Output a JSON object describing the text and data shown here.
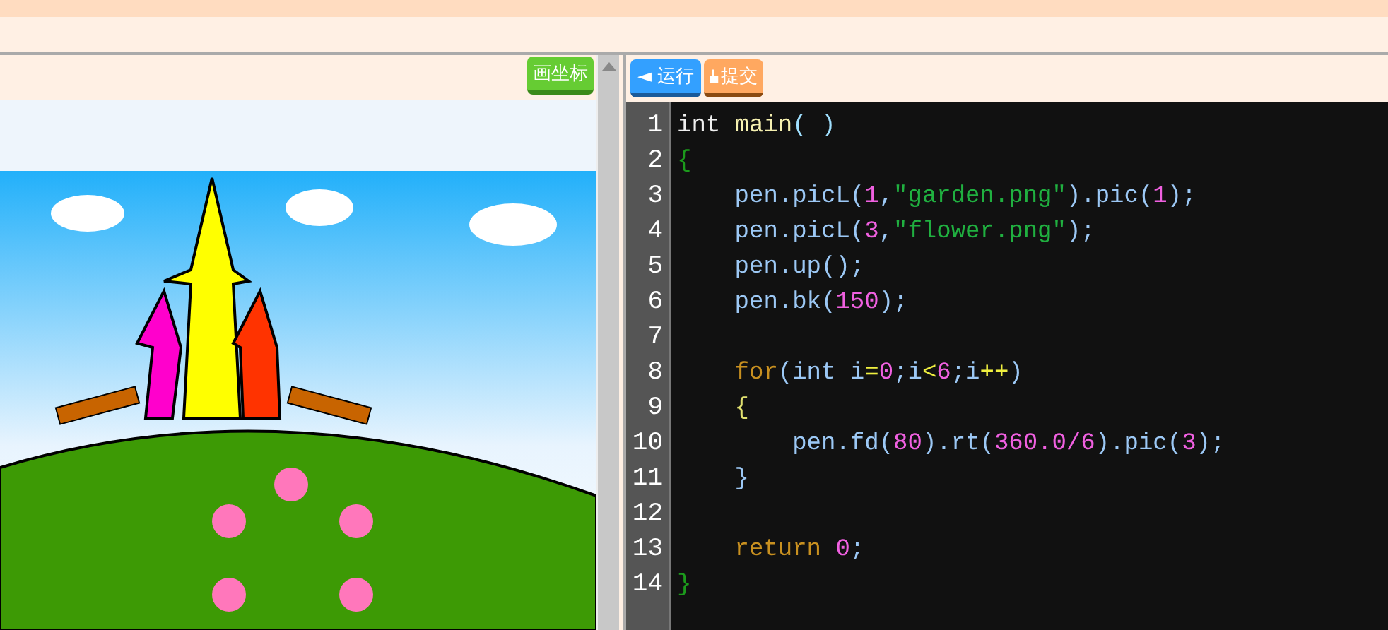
{
  "canvas_panel": {
    "button": "画坐标"
  },
  "editor": {
    "run_button": "◄ 运行",
    "submit_button": "提交",
    "lines": [
      {
        "number": "1",
        "tokens": [
          {
            "kind": "type",
            "text": "int"
          },
          {
            "kind": "func",
            "text": "main",
            "spaced": true
          },
          {
            "kind": "paren",
            "text": "( )"
          }
        ]
      },
      {
        "number": "2",
        "tokens": [
          {
            "kind": "brace",
            "text": "{"
          }
        ],
        "children": [
          {
            "number": "3",
            "tokens": [
              {
                "kind": "ident",
                "text": "pen.picL("
              },
              {
                "kind": "number",
                "text": "1"
              },
              {
                "kind": "ident",
                "text": ","
              },
              {
                "kind": "string",
                "text": "\"garden.png\""
              },
              {
                "kind": "ident",
                "text": ").pic("
              },
              {
                "kind": "number",
                "text": "1"
              },
              {
                "kind": "ident",
                "text": ");"
              }
            ]
          },
          {
            "number": "4",
            "tokens": [
              {
                "kind": "ident",
                "text": "pen.picL("
              },
              {
                "kind": "number",
                "text": "3"
              },
              {
                "kind": "ident",
                "text": ","
              },
              {
                "kind": "string",
                "text": "\"flower.png\""
              },
              {
                "kind": "ident",
                "text": ");"
              }
            ]
          },
          {
            "number": "5",
            "tokens": [
              {
                "kind": "ident",
                "text": "pen.up();"
              }
            ]
          },
          {
            "number": "6",
            "tokens": [
              {
                "kind": "ident",
                "text": "pen.bk("
              },
              {
                "kind": "number",
                "text": "150"
              },
              {
                "kind": "ident",
                "text": ");"
              }
            ]
          },
          {
            "number": "7"
          },
          {
            "number": "8",
            "tokens": [
              {
                "kind": "keyword",
                "text": "for"
              },
              {
                "kind": "ident",
                "text": "(int i"
              },
              {
                "kind": "operator",
                "text": "="
              },
              {
                "kind": "number",
                "text": "0"
              },
              {
                "kind": "ident",
                "text": ";i"
              },
              {
                "kind": "operator",
                "text": "<"
              },
              {
                "kind": "number",
                "text": "6"
              },
              {
                "kind": "ident",
                "text": ";i"
              },
              {
                "kind": "operator",
                "text": "++"
              },
              {
                "kind": "ident",
                "text": ")"
              }
            ]
          },
          {
            "number": "9",
            "tokens": [
              {
                "kind": "block",
                "text": "{"
              }
            ],
            "children": [
              {
                "number": "10",
                "tokens": [
                  {
                    "kind": "ident",
                    "text": "pen.fd("
                  },
                  {
                    "kind": "number",
                    "text": "80"
                  },
                  {
                    "kind": "ident",
                    "text": ").rt("
                  },
                  {
                    "kind": "number",
                    "text": "360.0/6"
                  },
                  {
                    "kind": "ident",
                    "text": ").pic("
                  },
                  {
                    "kind": "number",
                    "text": "3"
                  },
                  {
                    "kind": "ident",
                    "text": ");"
                  }
                ]
              }
            ]
          },
          {
            "number": "11",
            "tokens": [
              {
                "kind": "ident",
                "text": "}"
              }
            ]
          },
          {
            "number": "12"
          },
          {
            "number": "13",
            "tokens": [
              {
                "kind": "keyword",
                "text": "return"
              },
              {
                "kind": "number",
                "text": "0",
                "spaced": true
              },
              {
                "kind": "ident",
                "text": ";"
              }
            ]
          }
        ]
      },
      {
        "number": "14",
        "tokens": [
          {
            "kind": "brace",
            "text": "}"
          }
        ]
      }
    ]
  }
}
